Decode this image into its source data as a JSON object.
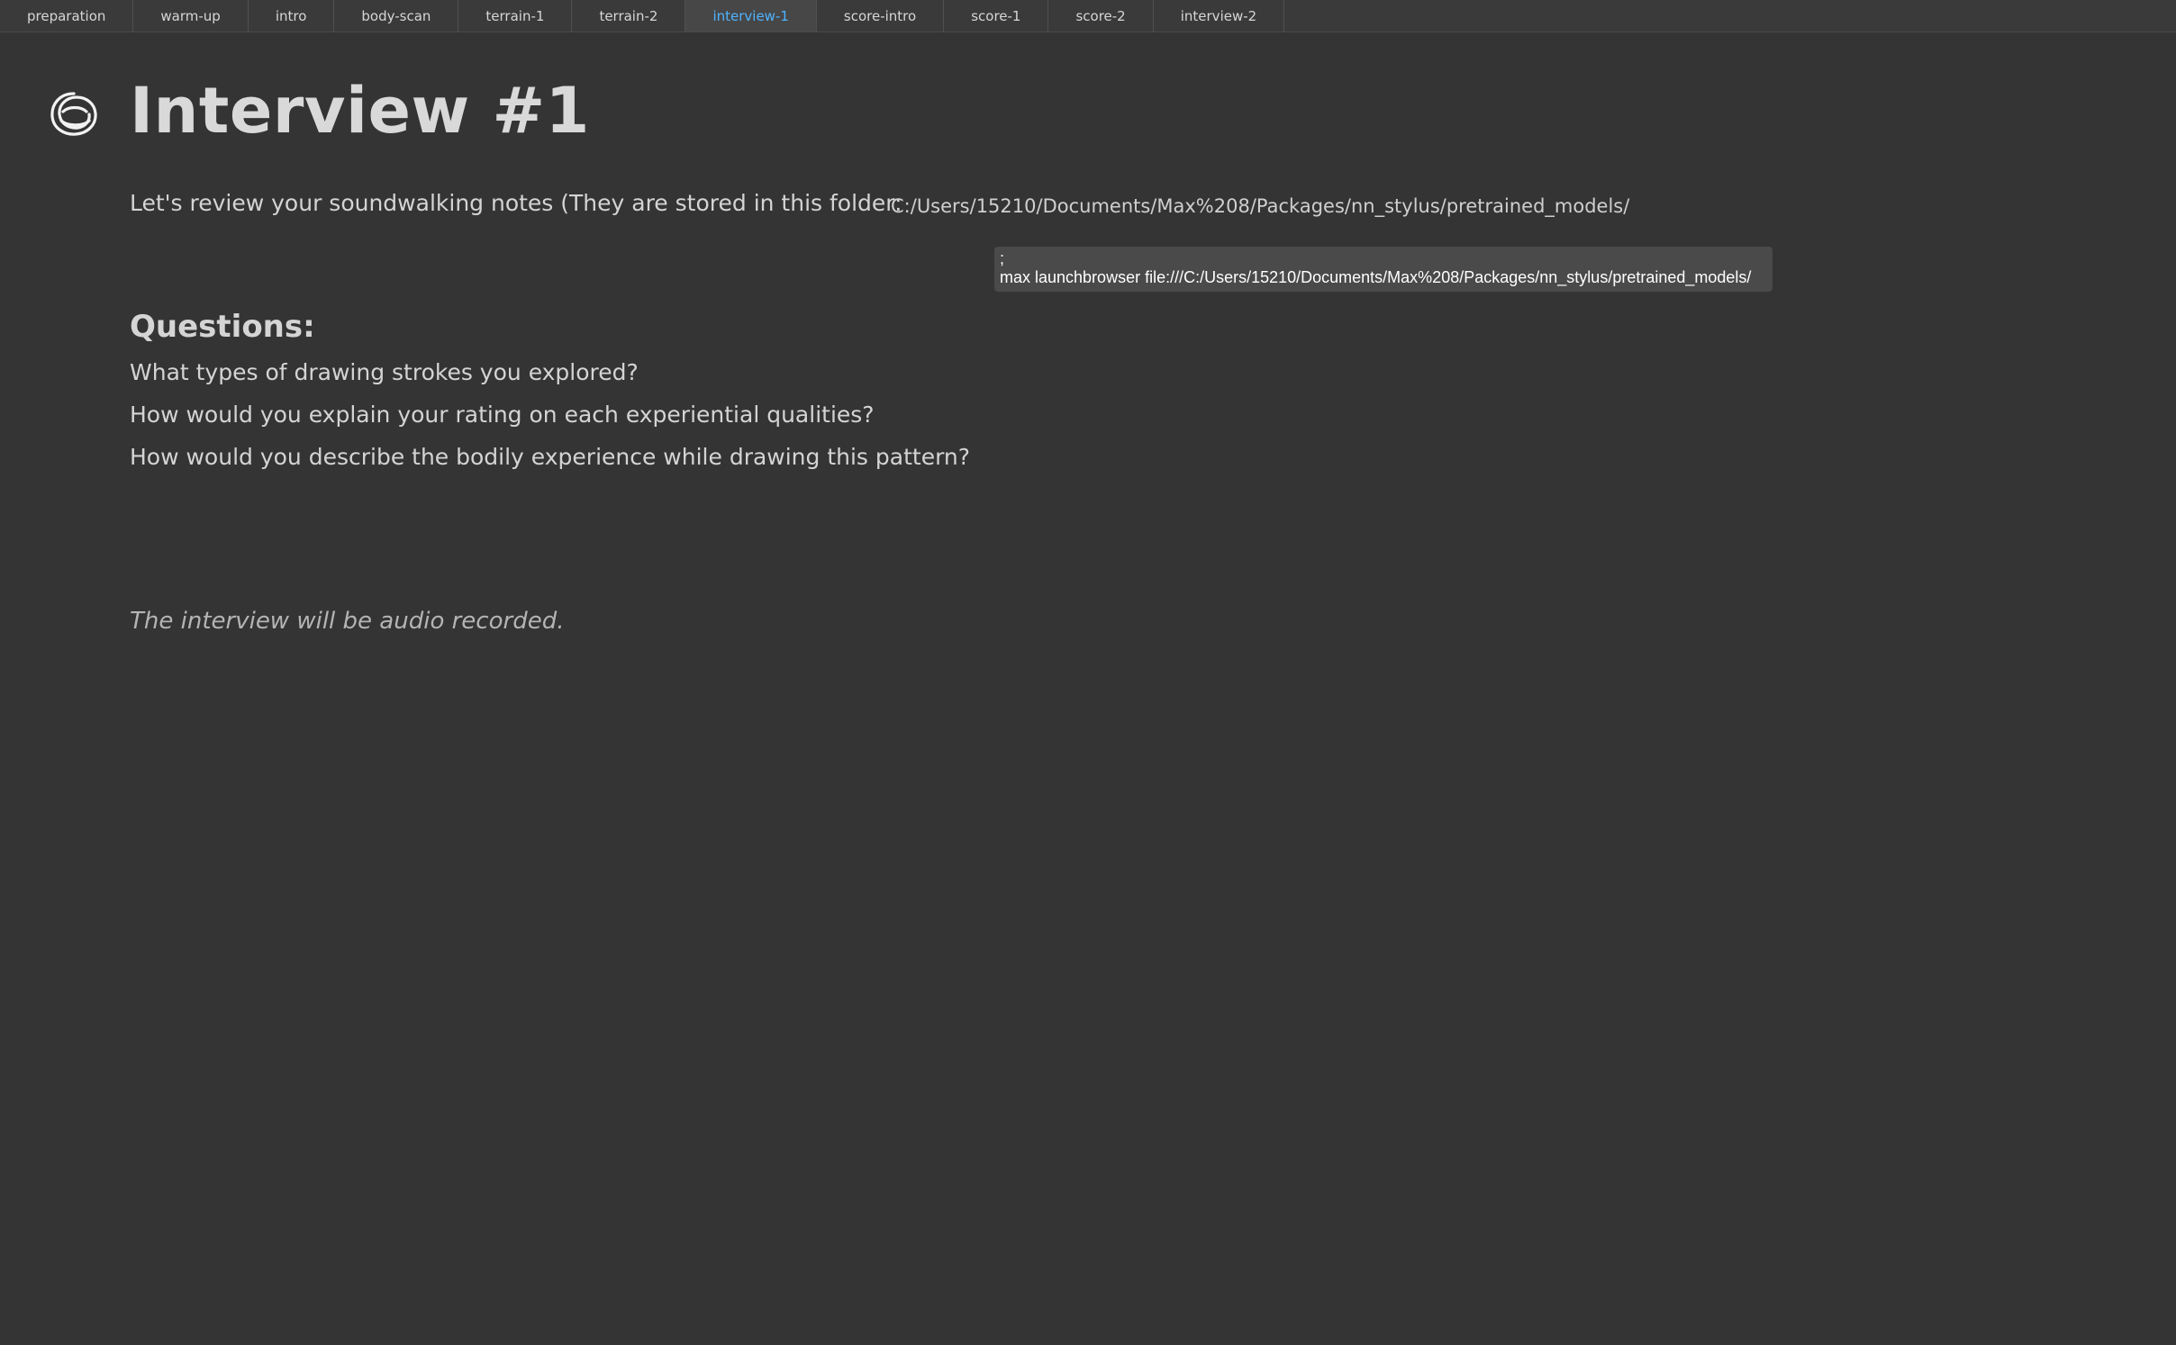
{
  "tabs": [
    {
      "label": "preparation",
      "active": false
    },
    {
      "label": "warm-up",
      "active": false
    },
    {
      "label": "intro",
      "active": false
    },
    {
      "label": "body-scan",
      "active": false
    },
    {
      "label": "terrain-1",
      "active": false
    },
    {
      "label": "terrain-2",
      "active": false
    },
    {
      "label": "interview-1",
      "active": true
    },
    {
      "label": "score-intro",
      "active": false
    },
    {
      "label": "score-1",
      "active": false
    },
    {
      "label": "score-2",
      "active": false
    },
    {
      "label": "interview-2",
      "active": false
    }
  ],
  "logo": {
    "icon": "scribble-circle-icon"
  },
  "page": {
    "title": "Interview #1",
    "notes_text": "Let's review your soundwalking notes (They are stored in this folder:",
    "folder_path": "C:/Users/15210/Documents/Max%208/Packages/nn_stylus/pretrained_models/"
  },
  "message_box": {
    "line1": ";",
    "line2": "max launchbrowser file:///C:/Users/15210/Documents/Max%208/Packages/nn_stylus/pretrained_models/"
  },
  "questions": {
    "heading": "Questions:",
    "items": [
      "What types of drawing strokes you explored?",
      "How would you explain your rating on each experiential qualities?",
      "How would you describe the bodily experience while drawing this pattern?"
    ]
  },
  "footnote": "The interview will be audio recorded.",
  "colors": {
    "background": "#343434",
    "active_tab_text": "#4fb3ff",
    "text": "#d4d4d4"
  }
}
